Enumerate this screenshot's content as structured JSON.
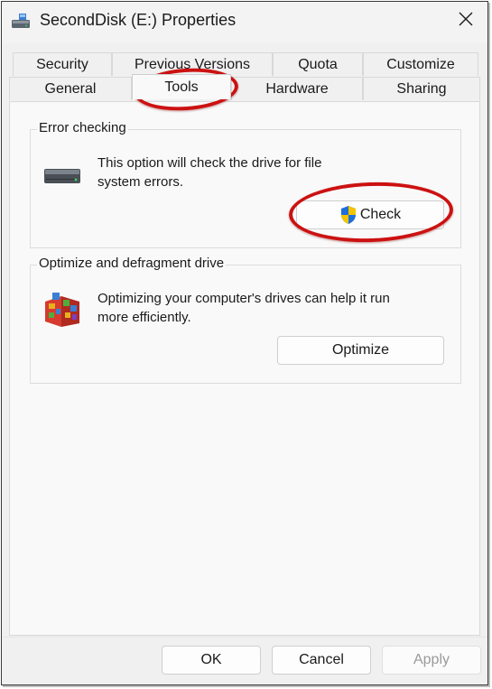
{
  "window": {
    "title": "SecondDisk (E:) Properties",
    "close_label": "✕"
  },
  "tabs": {
    "row_back": [
      "Security",
      "Previous Versions",
      "Quota",
      "Customize"
    ],
    "row_front": [
      "General",
      "Tools",
      "Hardware",
      "Sharing"
    ],
    "active": "Tools"
  },
  "error_checking": {
    "title": "Error checking",
    "description_line1": "This option will check the drive for file",
    "description_line2": "system errors.",
    "button_label": "Check",
    "icon": "drive-icon"
  },
  "optimize": {
    "title": "Optimize and defragment drive",
    "description_line1": "Optimizing your computer's drives can help it run",
    "description_line2": "more efficiently.",
    "button_label": "Optimize",
    "icon": "defrag-icon"
  },
  "footer": {
    "ok": "OK",
    "cancel": "Cancel",
    "apply": "Apply"
  },
  "colors": {
    "annotation": "#cc1111",
    "shield_blue": "#1e6fd9",
    "shield_yellow": "#f5c400"
  }
}
